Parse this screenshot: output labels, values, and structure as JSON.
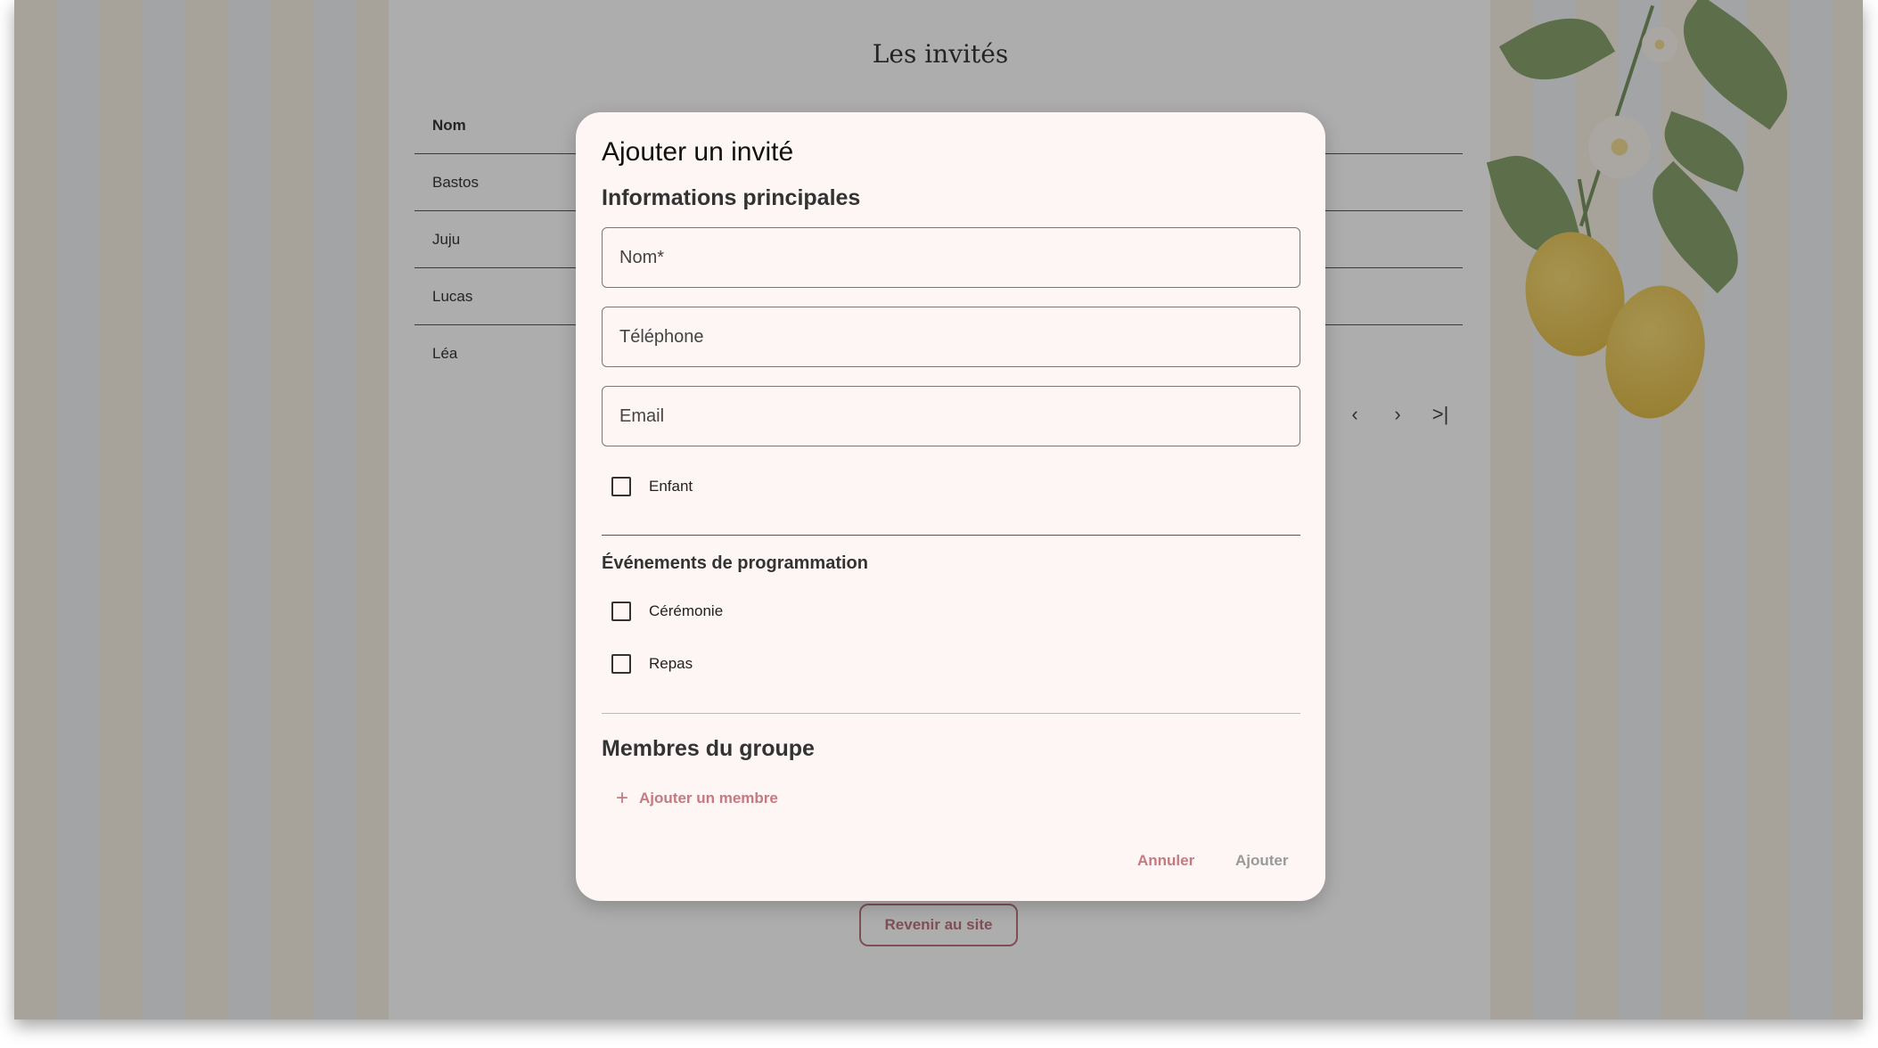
{
  "page": {
    "title": "Les invités",
    "back_button": "Revenir au site"
  },
  "table": {
    "header": "Nom",
    "rows": [
      "Bastos",
      "Juju",
      "Lucas",
      "Léa"
    ]
  },
  "pagination": {
    "prev_icon": "chevron-left-icon",
    "next_icon": "chevron-right-icon",
    "last_icon": "last-page-icon"
  },
  "dialog": {
    "title": "Ajouter un invité",
    "section_main": "Informations principales",
    "fields": {
      "name_placeholder": "Nom*",
      "phone_placeholder": "Téléphone",
      "email_placeholder": "Email"
    },
    "child_label": "Enfant",
    "section_events": "Événements de programmation",
    "events": [
      "Cérémonie",
      "Repas"
    ],
    "section_group": "Membres du groupe",
    "add_member": "Ajouter un membre",
    "cancel": "Annuler",
    "submit": "Ajouter"
  },
  "colors": {
    "accent": "#c47a80",
    "dialog_bg": "#fdf6f5",
    "scrim": "rgba(40,40,40,0.38)"
  }
}
